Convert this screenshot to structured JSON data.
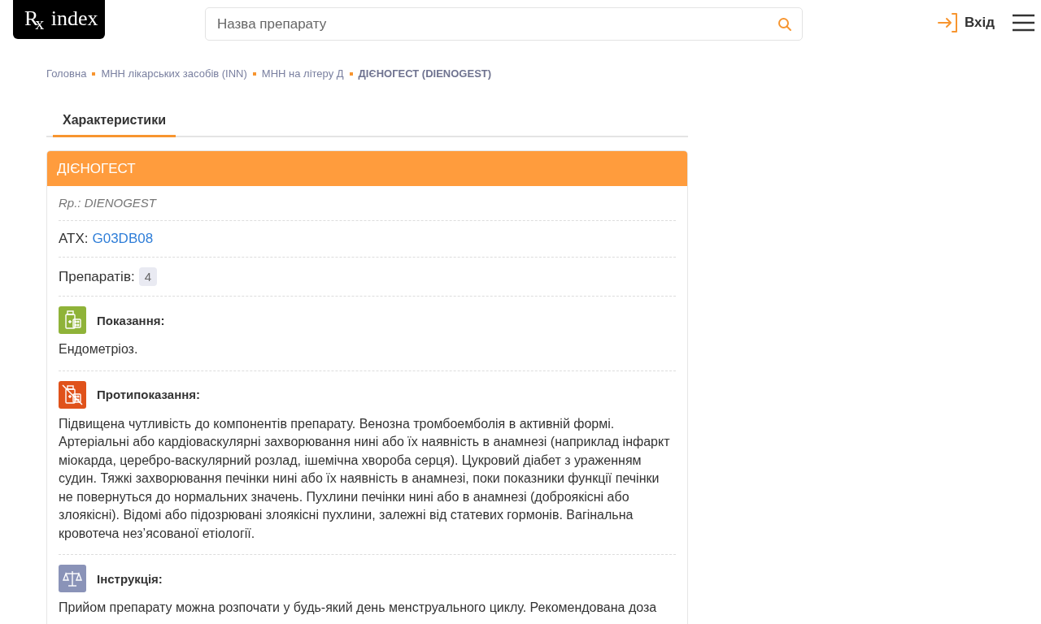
{
  "header": {
    "logo": "R$_{x}$ index",
    "search": {
      "placeholder": "Назва препарату"
    },
    "login": "Вхід"
  },
  "breadcrumbs": [
    {
      "label": "Головна",
      "current": false
    },
    {
      "label": "МНН лікарських засобів (INN)",
      "current": false
    },
    {
      "label": "МНН на літеру Д",
      "current": false
    },
    {
      "label": "ДІЄНОГЕСТ (DIENOGEST)",
      "current": true
    }
  ],
  "tabs": [
    {
      "label": "Характеристики",
      "selected": true
    }
  ],
  "card": {
    "title": "ДІЄНОГЕСТ",
    "latin": "Rp.: DIENOGEST",
    "atc_label": "АТХ:",
    "atc_code": "G03DB08",
    "count_label": "Препаратів:",
    "count": "4",
    "sections": [
      {
        "kind": "indications",
        "title": "Показання:",
        "text": "Ендометріоз."
      },
      {
        "kind": "contraindications",
        "title": "Протипоказання:",
        "text": "Підвищена чутливість до компонентів препарату. Венозна тромбоемболія в активній формі. Артеріальні або кардіоваскулярні захворювання нині або їх наявність в анамнезі (наприклад інфаркт міокарда, церебро-васкулярний розлад, ішемічна хвороба серця). Цукровий діабет з ураженням судин. Тяжкі захворювання печінки нині або їх наявність в анамнезі, поки показники функції печінки не повернуться до нормальних значень. Пухлини печінки нині або в анамнезі (доброякісні або злоякісні). Відомі або підозрювані злоякісні пухлини, залежні від статевих гормонів. Вагінальна кровотеча нез’ясованої етіології."
      },
      {
        "kind": "instruction",
        "title": "Інструкція:",
        "text": "Прийом препарату можна розпочати у будь-який день менструального циклу. Рекомендована доза"
      }
    ]
  }
}
